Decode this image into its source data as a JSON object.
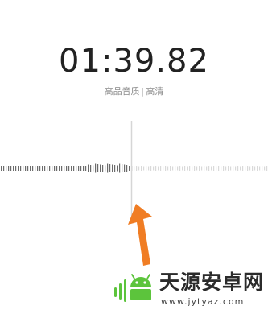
{
  "recorder": {
    "elapsed_time": "01:39.82",
    "quality_label": "高品音质",
    "quality_separator": "|",
    "quality_value": "高清"
  },
  "colors": {
    "recorded_bar": "#6b6b6b",
    "pending_bar": "#d9d9d9",
    "playhead": "#d6d6d6",
    "arrow": "#f07d24"
  },
  "watermark": {
    "title": "天源安卓网",
    "url": "www.jytyaz.com",
    "logo_color": "#5cc43c"
  }
}
